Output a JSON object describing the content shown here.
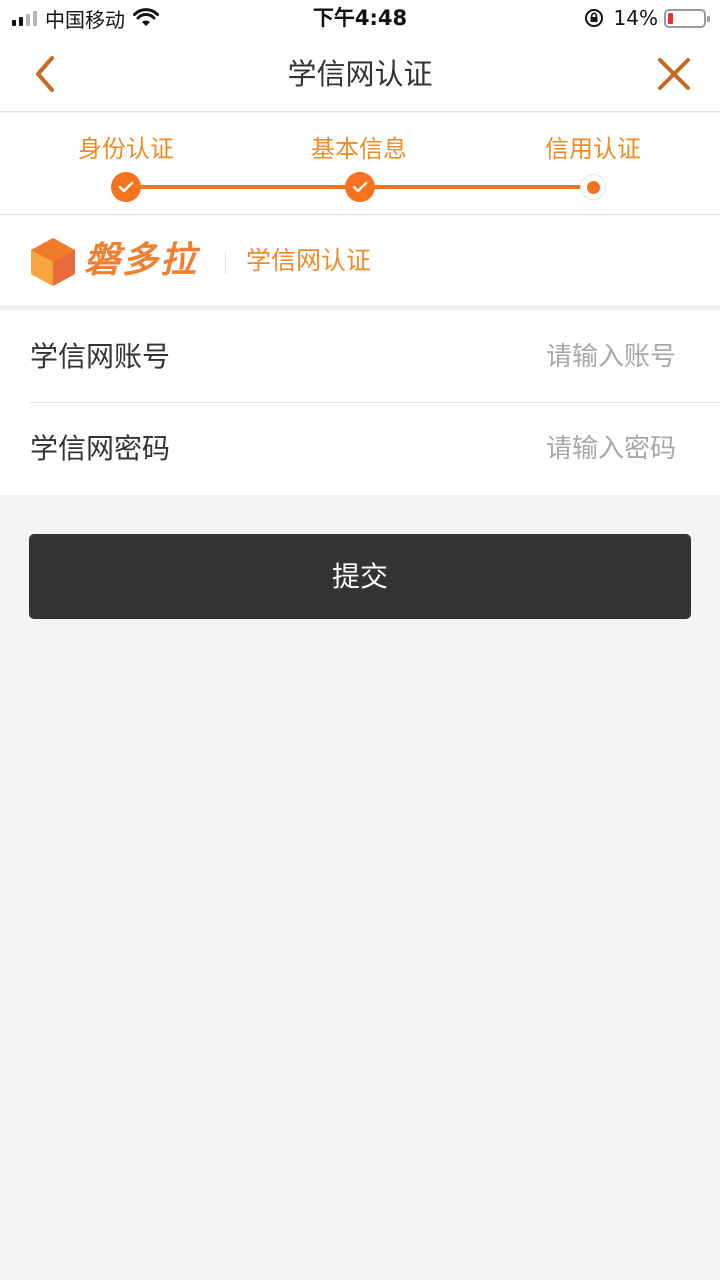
{
  "status_bar": {
    "carrier": "中国移动",
    "time": "下午4:48",
    "battery_percent": "14%",
    "battery_level": 0.14,
    "signal_bars_active": 2,
    "signal_bars_total": 4
  },
  "nav": {
    "title": "学信网认证",
    "back_icon": "chevron-left-icon",
    "close_icon": "close-icon"
  },
  "steps": [
    {
      "label": "身份认证",
      "state": "done"
    },
    {
      "label": "基本信息",
      "state": "done"
    },
    {
      "label": "信用认证",
      "state": "current"
    }
  ],
  "brand": {
    "name": "磐多拉",
    "subtitle": "学信网认证"
  },
  "form": {
    "account": {
      "label": "学信网账号",
      "placeholder": "请输入账号",
      "value": ""
    },
    "password": {
      "label": "学信网密码",
      "placeholder": "请输入密码",
      "value": ""
    }
  },
  "submit_label": "提交",
  "colors": {
    "accent": "#f5731f",
    "accent_text": "#f08a25",
    "button": "#333333",
    "page_bg": "#f4f4f4"
  }
}
